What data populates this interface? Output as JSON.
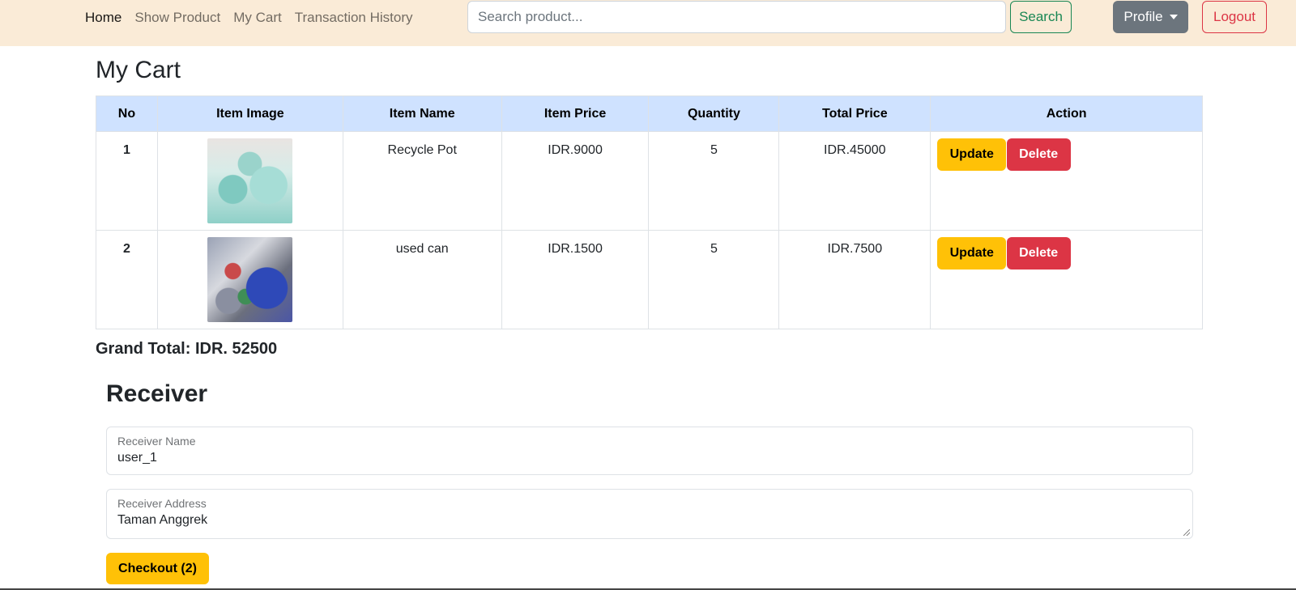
{
  "nav": {
    "links": [
      "Home",
      "Show Product",
      "My Cart",
      "Transaction History"
    ],
    "search_placeholder": "Search product...",
    "search_label": "Search",
    "profile_label": "Profile",
    "logout_label": "Logout"
  },
  "cart": {
    "title": "My Cart",
    "headers": [
      "No",
      "Item Image",
      "Item Name",
      "Item Price",
      "Quantity",
      "Total Price",
      "Action"
    ],
    "rows": [
      {
        "no": "1",
        "image": "recycle-pot-image",
        "name": "Recycle Pot",
        "price": "IDR.9000",
        "quantity": "5",
        "total": "IDR.45000",
        "update_label": "Update",
        "delete_label": "Delete"
      },
      {
        "no": "2",
        "image": "used-can-image",
        "name": "used can",
        "price": "IDR.1500",
        "quantity": "5",
        "total": "IDR.7500",
        "update_label": "Update",
        "delete_label": "Delete"
      }
    ],
    "grand_total": "Grand Total: IDR. 52500"
  },
  "receiver": {
    "title": "Receiver",
    "name_label": "Receiver Name",
    "name_value": "user_1",
    "address_label": "Receiver Address",
    "address_value": "Taman Anggrek",
    "checkout_label": "Checkout (2)"
  },
  "colors": {
    "navbar_bg": "#faebd7",
    "header_bg": "#cfe2ff",
    "warning": "#ffc107",
    "danger": "#dc3545",
    "success": "#198754",
    "secondary": "#6c757d"
  }
}
